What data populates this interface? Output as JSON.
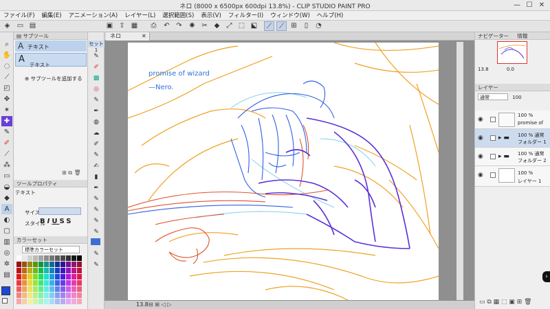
{
  "window": {
    "title": "ネロ (8000 x 6500px 600dpi 13.8%)  - CLIP STUDIO PAINT PRO",
    "minimize": "—",
    "maximize": "☐",
    "close": "✕"
  },
  "menu": [
    "ファイル(F)",
    "編集(E)",
    "アニメーション(A)",
    "レイヤー(L)",
    "選択範囲(S)",
    "表示(V)",
    "フィルター(I)",
    "ウィンドウ(W)",
    "ヘルプ(H)"
  ],
  "subtool": {
    "tab_label": "サブツール",
    "tab_icon": "A",
    "group_name": "テキスト",
    "item_label": "テキスト",
    "add_label": "サブツールを追加する",
    "set_label": "セット1"
  },
  "toolprop": {
    "header": "ツールプロパティ",
    "tool_name": "テキスト",
    "size_label": "サイズ",
    "style_label": "スタイル",
    "style_buttons": [
      "B",
      "I",
      "U",
      "S",
      "S"
    ]
  },
  "colorset": {
    "header": "カラーセット",
    "selected_set": "標準カラーセット"
  },
  "canvas": {
    "tab_label": "ネロ",
    "zoom": "13.8",
    "text_line1": "promise of wizard",
    "text_line2": "—Nero."
  },
  "navigator": {
    "header": "ナビゲーター",
    "tab2": "情報",
    "zoom": "13.8",
    "angle": "0.0"
  },
  "layers": {
    "header": "レイヤー",
    "blend_mode": "通常",
    "opacity": "100",
    "items": [
      {
        "opacity": "100 %",
        "name": "promise of",
        "type": "text"
      },
      {
        "opacity": "100 % 通常",
        "name": "フォルダー 1",
        "type": "folder"
      },
      {
        "opacity": "100 % 通常",
        "name": "フォルダー 2",
        "type": "folder"
      },
      {
        "opacity": "100 %",
        "name": "レイヤー 1",
        "type": "paper"
      }
    ]
  },
  "colors": {
    "accent": "#3c6fd1",
    "sketch_orange": "#f0a020",
    "sketch_purple": "#5a2fd9",
    "sketch_blue": "#2f5ee6",
    "sketch_red": "#e0512c",
    "sketch_cyan": "#7fd0f0",
    "canvas_text": "#2f6fd8"
  }
}
